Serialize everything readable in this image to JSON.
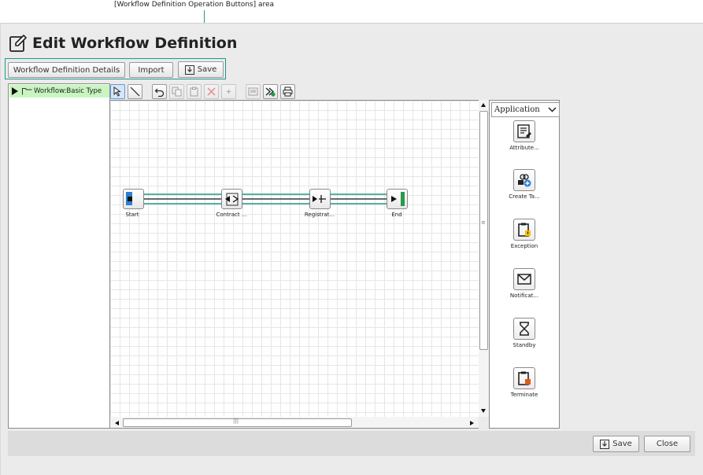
{
  "annotation": {
    "text": "[Workflow Definition Operation Buttons] area"
  },
  "header": {
    "title": "Edit Workflow Definition"
  },
  "operation_buttons": {
    "details_label": "Workflow Definition Details",
    "import_label": "Import",
    "save_label": "Save"
  },
  "tree": {
    "item_label": "Workflow:Basic Type"
  },
  "palette": {
    "dropdown_value": "Application",
    "items": [
      {
        "label": "Attribute...",
        "icon": "attribute-icon"
      },
      {
        "label": "Create Ta...",
        "icon": "create-task-icon"
      },
      {
        "label": "Exception",
        "icon": "exception-icon"
      },
      {
        "label": "Notificat...",
        "icon": "notification-icon"
      },
      {
        "label": "Standby",
        "icon": "hourglass-icon"
      },
      {
        "label": "Terminate",
        "icon": "terminate-icon"
      }
    ]
  },
  "workflow_nodes": [
    {
      "label": "Start",
      "icon": "start-node-icon"
    },
    {
      "label": "Contract ...",
      "icon": "contract-node-icon"
    },
    {
      "label": "Registrat...",
      "icon": "registration-node-icon"
    },
    {
      "label": "End",
      "icon": "end-node-icon"
    }
  ],
  "footer": {
    "save_label": "Save",
    "close_label": "Close"
  },
  "colors": {
    "callout": "#1a9a8a",
    "tree_selected": "#c8f5c0",
    "connector": "#1a9a8a"
  }
}
